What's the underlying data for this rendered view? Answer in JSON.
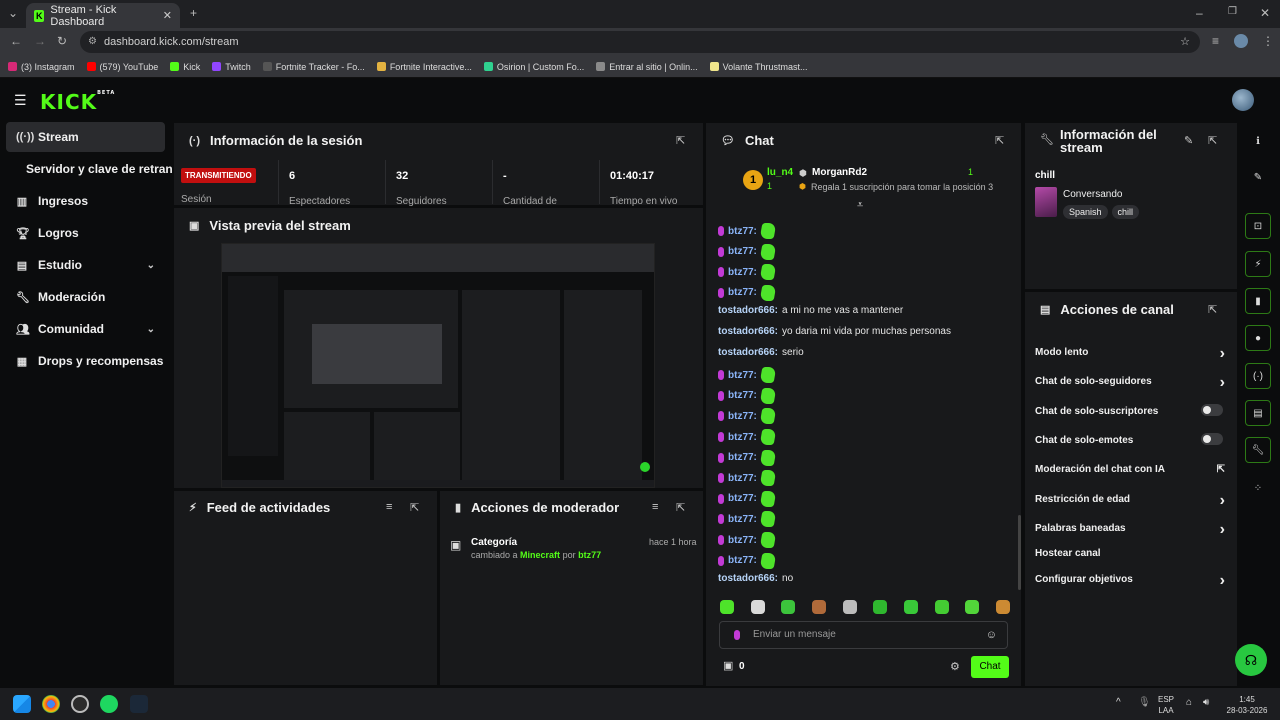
{
  "browser": {
    "tab_title": "Stream - Kick Dashboard",
    "url": "dashboard.kick.com/stream",
    "bookmarks": [
      {
        "label": "(3) Instagram",
        "color": "#d62976"
      },
      {
        "label": "(579) YouTube",
        "color": "#ff0000"
      },
      {
        "label": "Kick",
        "color": "#53fc18"
      },
      {
        "label": "Twitch",
        "color": "#9146ff"
      },
      {
        "label": "Fortnite Tracker - Fo...",
        "color": "#555555"
      },
      {
        "label": "Fortnite Interactive...",
        "color": "#e3b341"
      },
      {
        "label": "Osirion | Custom Fo...",
        "color": "#2fd18f"
      },
      {
        "label": "Entrar al sitio | Onlin...",
        "color": "#8a8a8a"
      },
      {
        "label": "Volante Thrustmast...",
        "color": "#f0e68c"
      }
    ]
  },
  "brand": {
    "logo": "KICK",
    "beta": "BETA",
    "accent": "#53fc18"
  },
  "sidebar": {
    "items": [
      {
        "label": "Stream",
        "icon": "broadcast-icon"
      },
      {
        "label": "Servidor y clave de retransm"
      },
      {
        "label": "Ingresos",
        "icon": "chart-icon"
      },
      {
        "label": "Logros",
        "icon": "trophy-icon"
      },
      {
        "label": "Estudio",
        "icon": "studio-icon"
      },
      {
        "label": "Moderación",
        "icon": "wrench-icon"
      },
      {
        "label": "Comunidad",
        "icon": "community-icon"
      },
      {
        "label": "Drops y recompensas",
        "icon": "drops-icon"
      }
    ]
  },
  "session": {
    "title": "Información de la sesión",
    "status": "TRANSMITIENDO",
    "label": "Sesión",
    "stats": [
      {
        "value": "6",
        "label": "Espectadores"
      },
      {
        "value": "32",
        "label": "Seguidores"
      },
      {
        "value": "-",
        "label": "Cantidad de"
      },
      {
        "value": "01:40:17",
        "label": "Tiempo en vivo"
      }
    ]
  },
  "preview": {
    "title": "Vista previa del stream"
  },
  "feed": {
    "title": "Feed de actividades"
  },
  "mod_actions": {
    "title": "Acciones de moderador",
    "entry_title": "Categoría",
    "entry_time": "hace 1 hora",
    "entry_prefix": "cambiado a",
    "entry_game": "Minecraft",
    "entry_by": "por",
    "entry_user": "btz77"
  },
  "chat": {
    "title": "Chat",
    "top_rank": "1",
    "top_user": "lu_n4",
    "top_user_count": "1",
    "second_user": "MorganRd2",
    "second_count": "1",
    "gift_text": "Regala 1 suscripción para tomar la posición 3",
    "messages": [
      {
        "user": "btz77:",
        "text": ""
      },
      {
        "user": "btz77:",
        "text": ""
      },
      {
        "user": "btz77:",
        "text": ""
      },
      {
        "user": "btz77:",
        "text": ""
      },
      {
        "user": "tostador666:",
        "text": "a mi no me vas a mantener"
      },
      {
        "user": "tostador666:",
        "text": "yo daria mi vida por muchas personas"
      },
      {
        "user": "tostador666:",
        "text": "serio"
      },
      {
        "user": "btz77:",
        "text": ""
      },
      {
        "user": "btz77:",
        "text": ""
      },
      {
        "user": "btz77:",
        "text": ""
      },
      {
        "user": "btz77:",
        "text": ""
      },
      {
        "user": "btz77:",
        "text": ""
      },
      {
        "user": "btz77:",
        "text": ""
      },
      {
        "user": "btz77:",
        "text": ""
      },
      {
        "user": "btz77:",
        "text": ""
      },
      {
        "user": "btz77:",
        "text": ""
      },
      {
        "user": "btz77:",
        "text": ""
      },
      {
        "user": "tostador666:",
        "text": "no"
      }
    ],
    "placeholder": "Enviar un mensaje",
    "points": "0",
    "send_label": "Chat"
  },
  "stream_info": {
    "title": "Información del stream",
    "stream_title": "chill",
    "category": "Conversando",
    "tags": [
      "Spanish",
      "chill"
    ]
  },
  "channel_actions": {
    "title": "Acciones de canal",
    "items": [
      {
        "label": "Modo lento",
        "control": "chevron"
      },
      {
        "label": "Chat de solo-seguidores",
        "control": "chevron"
      },
      {
        "label": "Chat de solo-suscriptores",
        "control": "toggle"
      },
      {
        "label": "Chat de solo-emotes",
        "control": "toggle"
      },
      {
        "label": "Moderación del chat con IA",
        "control": "external"
      },
      {
        "label": "Restricción de edad",
        "control": "chevron"
      },
      {
        "label": "Palabras baneadas",
        "control": "chevron"
      },
      {
        "label": "Hostear canal",
        "control": "none"
      },
      {
        "label": "Configurar objetivos",
        "control": "chevron"
      }
    ]
  },
  "taskbar": {
    "lang_top": "ESP",
    "lang_bottom": "LAA",
    "time": "1:45",
    "date": "28-03-2026"
  }
}
